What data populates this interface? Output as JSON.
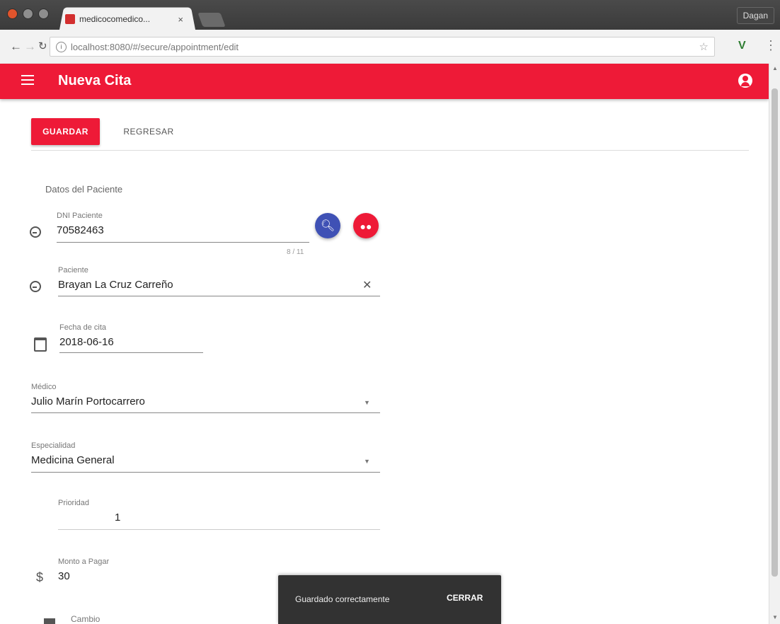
{
  "browser": {
    "tab_title": "medicocomedico...",
    "tab_close": "×",
    "user_button": "Dagan",
    "url": "localhost:8080/#/secure/appointment/edit",
    "star": "☆",
    "ext_icon": "V",
    "menu": "⋮"
  },
  "app": {
    "title": "Nueva Cita",
    "accent": "#ee1a37"
  },
  "actions": {
    "save": "GUARDAR",
    "back": "REGRESAR"
  },
  "form": {
    "section_title": "Datos del Paciente",
    "patient_id": {
      "label": "DNI Paciente",
      "value": "70582463",
      "counter": "8 / 11"
    },
    "patient": {
      "label": "Paciente",
      "value": "Brayan La Cruz Carreño"
    },
    "date": {
      "label": "Fecha de cita",
      "value": "2018-06-16"
    },
    "doctor": {
      "label": "Médico",
      "value": "Julio Marín Portocarrero"
    },
    "specialty": {
      "label": "Especialidad",
      "value": "Medicina General"
    },
    "priority": {
      "label": "Prioridad",
      "value": "1"
    },
    "amount": {
      "label": "Monto a Pagar",
      "value": "30",
      "symbol": "$"
    },
    "next_label": "Cambio"
  },
  "snackbar": {
    "message": "Guardado correctamente",
    "action": "CERRAR"
  }
}
